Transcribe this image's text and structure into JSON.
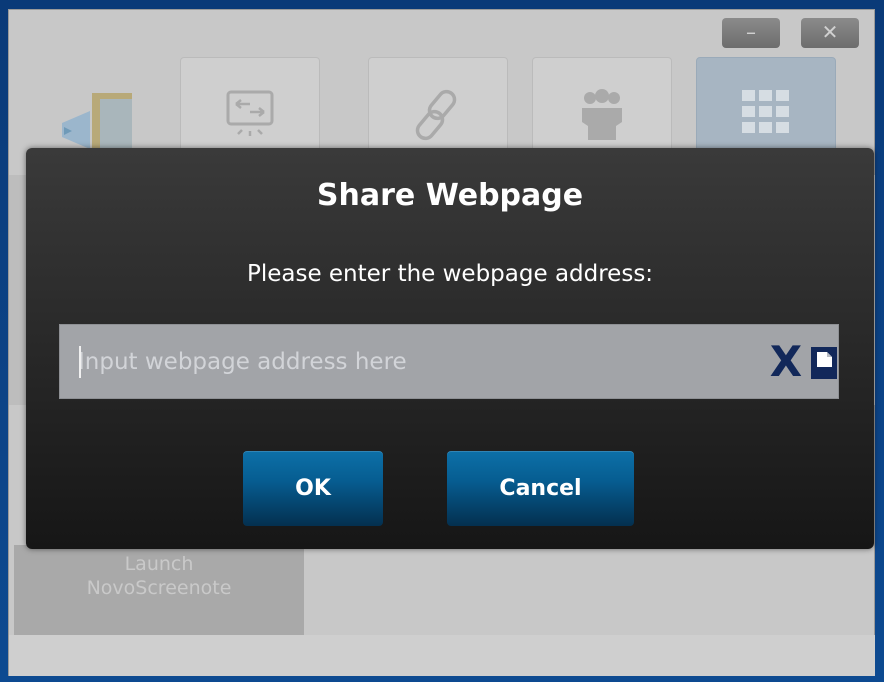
{
  "window": {
    "controls": {
      "minimize_label": "–",
      "close_label": "✕"
    }
  },
  "toolbar": {
    "tiles": [
      {
        "icon": "novo-logo-icon"
      },
      {
        "icon": "screen-share-icon"
      },
      {
        "icon": "link-icon"
      },
      {
        "icon": "group-icon"
      },
      {
        "icon": "apps-grid-icon",
        "selected": true
      }
    ]
  },
  "background": {
    "launch_tile_label": "Launch\nNovoScreenote"
  },
  "dialog": {
    "title": "Share Webpage",
    "prompt": "Please enter the webpage address:",
    "url_input": {
      "value": "",
      "placeholder": "Input webpage address here"
    },
    "clear_icon_label": "X",
    "ok_label": "OK",
    "cancel_label": "Cancel"
  },
  "colors": {
    "dialog_bg": "#2a2a2a",
    "button_blue": "#065d91",
    "icon_navy": "#12285a",
    "input_bg": "#a2a4a8"
  }
}
